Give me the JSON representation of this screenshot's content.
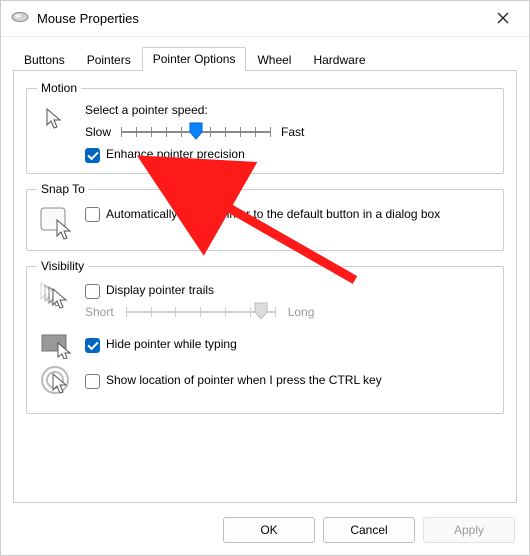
{
  "window": {
    "title": "Mouse Properties"
  },
  "tabs": {
    "items": [
      {
        "label": "Buttons"
      },
      {
        "label": "Pointers"
      },
      {
        "label": "Pointer Options"
      },
      {
        "label": "Wheel"
      },
      {
        "label": "Hardware"
      }
    ],
    "active_index": 2
  },
  "motion": {
    "legend": "Motion",
    "label_select_speed": "Select a pointer speed:",
    "slow": "Slow",
    "fast": "Fast",
    "slider_value_percent": 50,
    "enhance_label": "Enhance pointer precision",
    "enhance_checked": true
  },
  "snap_to": {
    "legend": "Snap To",
    "auto_move_label": "Automatically move pointer to the default button in a dialog box",
    "auto_move_checked": false
  },
  "visibility": {
    "legend": "Visibility",
    "trails_label": "Display pointer trails",
    "trails_checked": false,
    "trails_short": "Short",
    "trails_long": "Long",
    "trails_slider_value_percent": 90,
    "hide_typing_label": "Hide pointer while typing",
    "hide_typing_checked": true,
    "ctrl_locate_label": "Show location of pointer when I press the CTRL key",
    "ctrl_locate_checked": false
  },
  "buttons": {
    "ok": "OK",
    "cancel": "Cancel",
    "apply": "Apply",
    "apply_enabled": false
  },
  "annotation": {
    "arrow_target": "enhance-pointer-precision"
  }
}
